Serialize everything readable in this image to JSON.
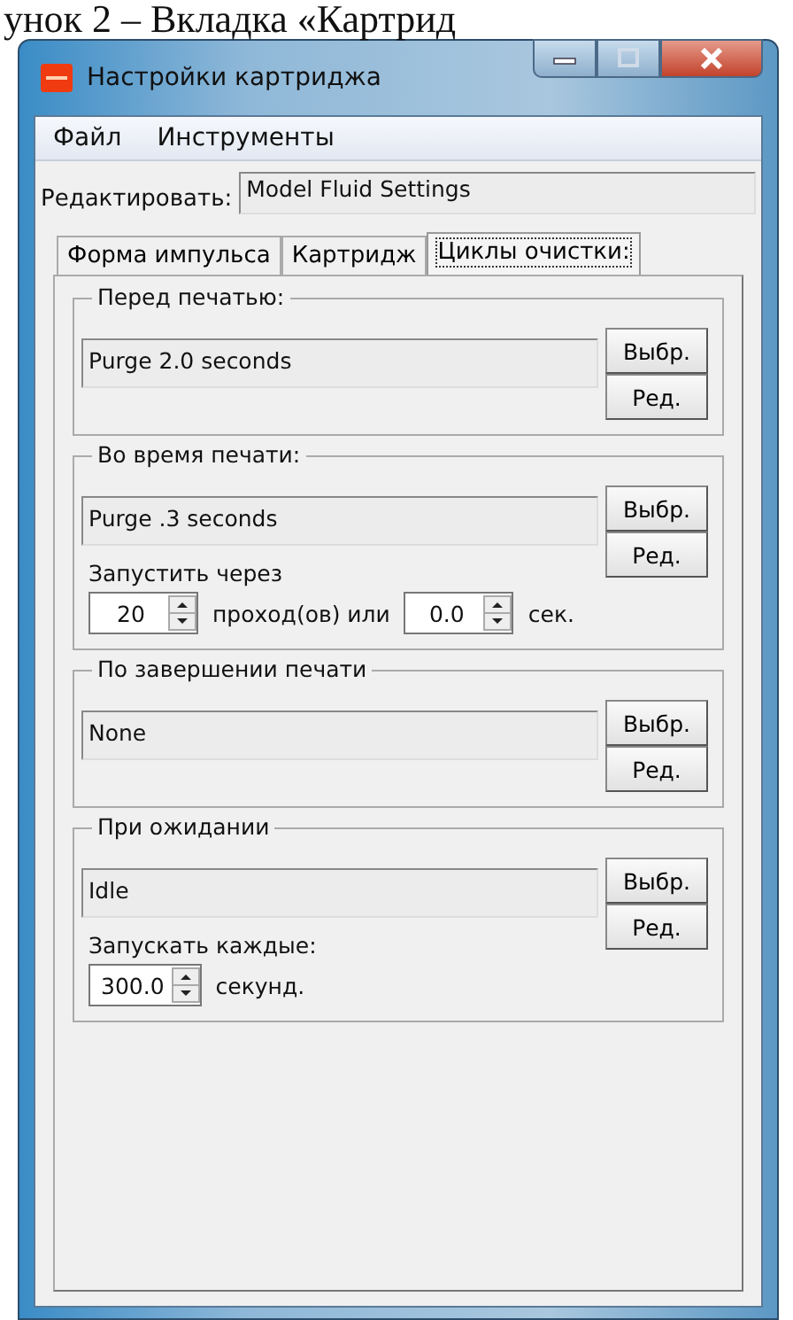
{
  "caption": "унок 2 – Вкладка «Картрид",
  "window": {
    "title": "Настройки картриджа"
  },
  "menu": [
    "Файл",
    "Инструменты"
  ],
  "edit": {
    "label": "Редактировать:",
    "value": "Model Fluid Settings"
  },
  "tabs": [
    {
      "label": "Форма импульса",
      "selected": false
    },
    {
      "label": "Картридж",
      "selected": false
    },
    {
      "label": "Циклы очистки:",
      "selected": true
    }
  ],
  "groups": [
    {
      "title": "Перед печатью:",
      "value": "Purge 2.0 seconds",
      "buttons": [
        "Выбр.",
        "Ред."
      ]
    },
    {
      "title": "Во время печати:",
      "value": "Purge .3 seconds",
      "buttons": [
        "Выбр.",
        "Ред."
      ],
      "run_label": "Запустить через",
      "run": [
        {
          "kind": "spin",
          "value": "20"
        },
        {
          "kind": "text",
          "text": "проход(ов) или"
        },
        {
          "kind": "spin",
          "value": "0.0"
        },
        {
          "kind": "text",
          "text": "сек."
        }
      ]
    },
    {
      "title": "По завершении печати",
      "value": "None",
      "buttons": [
        "Выбр.",
        "Ред."
      ]
    },
    {
      "title": "При ожидании",
      "value": "Idle",
      "buttons": [
        "Выбр.",
        "Ред."
      ],
      "run_label": "Запускать каждые:",
      "run": [
        {
          "kind": "spin",
          "value": "300.0"
        },
        {
          "kind": "text",
          "text": "секунд."
        }
      ]
    }
  ]
}
